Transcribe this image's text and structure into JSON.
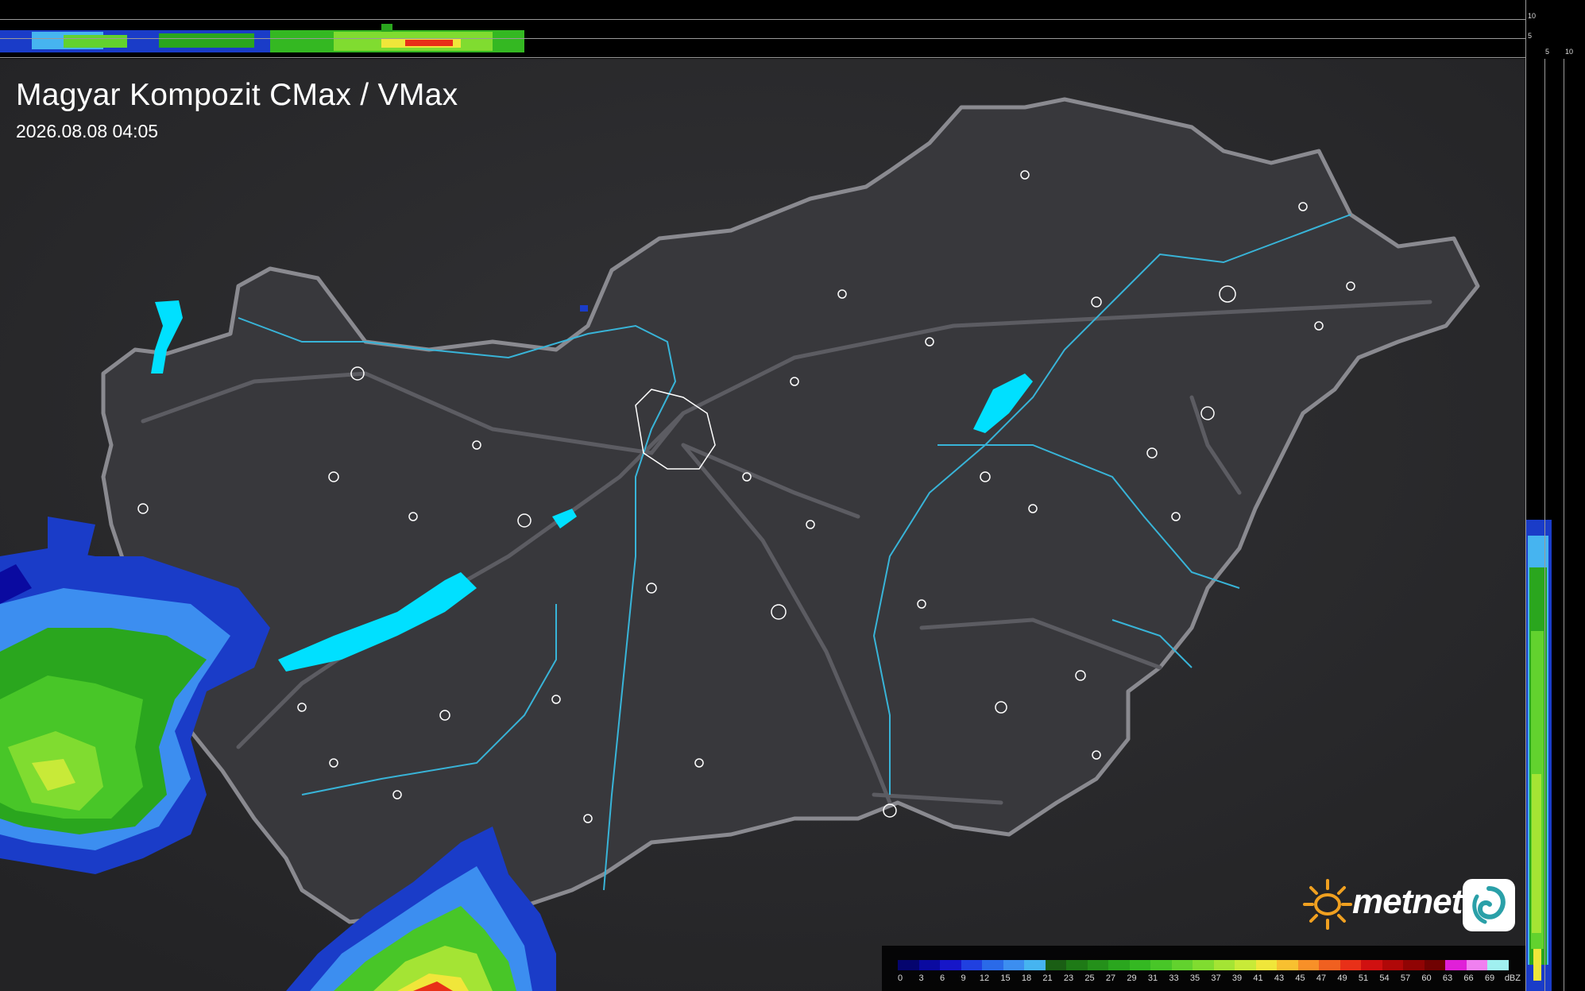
{
  "title": "Magyar Kompozit CMax / VMax",
  "timestamp": "2026.08.08 04:05",
  "brand": "metnet",
  "icons": [
    "sun-logo-icon",
    "swirl-logo-icon"
  ],
  "profile_ticks": {
    "top": [
      "10",
      "5"
    ],
    "right": [
      "5",
      "10"
    ]
  },
  "legend": {
    "unit": "dBZ",
    "labels": [
      "0",
      "3",
      "6",
      "9",
      "12",
      "15",
      "18",
      "21",
      "23",
      "25",
      "27",
      "29",
      "31",
      "33",
      "35",
      "37",
      "39",
      "41",
      "43",
      "45",
      "47",
      "49",
      "51",
      "54",
      "57",
      "60",
      "63",
      "66",
      "69"
    ],
    "colors": [
      "#05056e",
      "#0a0aa0",
      "#1616c8",
      "#2040e0",
      "#2a6ae8",
      "#3c8ef0",
      "#46b4f0",
      "#1a5e14",
      "#1e7a16",
      "#24901a",
      "#2aa61e",
      "#34b822",
      "#48c628",
      "#62d22e",
      "#80dc30",
      "#a4e434",
      "#c8ea38",
      "#f0e63a",
      "#f8c030",
      "#f89028",
      "#f06020",
      "#e83018",
      "#d01010",
      "#b00808",
      "#900404",
      "#700202",
      "#e020d8",
      "#f080f0",
      "#a0f0f0"
    ]
  },
  "colors": {
    "background": "#2b2b2d",
    "country_fill": "#3a3a3e",
    "border": "#8a8a90",
    "rivers": "#38b4d8",
    "lakes": "#00e0ff",
    "cities": "#ffffff"
  }
}
